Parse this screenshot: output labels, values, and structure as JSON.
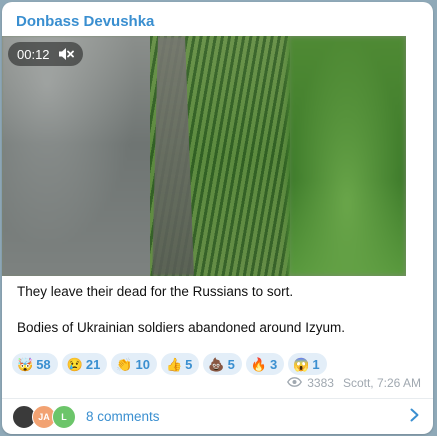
{
  "post": {
    "channel_name": "Donbass Devushka",
    "video": {
      "duration": "00:12",
      "muted_icon": "mute-icon"
    },
    "caption_line1": "They leave their dead for the Russians to sort.",
    "caption_line2": "Bodies of Ukrainian soldiers abandoned around Izyum.",
    "reactions": [
      {
        "emoji": "🤯",
        "count": "58"
      },
      {
        "emoji": "😢",
        "count": "21"
      },
      {
        "emoji": "👏",
        "count": "10"
      },
      {
        "emoji": "👍",
        "count": "5"
      },
      {
        "emoji": "💩",
        "count": "5"
      },
      {
        "emoji": "🔥",
        "count": "3"
      },
      {
        "emoji": "😱",
        "count": "1"
      }
    ],
    "views": "3383",
    "author_time": "Scott, 7:26 AM",
    "comments": {
      "label": "8 comments",
      "avatars": [
        "",
        "JA",
        "L"
      ]
    }
  },
  "colors": {
    "accent": "#3a8fd0",
    "reaction_bg": "#e3eef8",
    "meta": "#a0a8b0"
  }
}
